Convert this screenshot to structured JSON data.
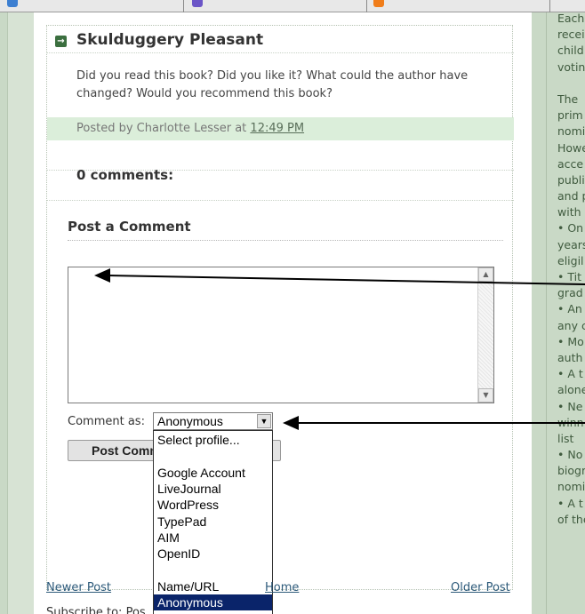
{
  "post": {
    "title": "Skulduggery Pleasant",
    "body": "Did you read this book? Did you like it? What could the author have changed? Would you recommend this book?",
    "footer_prefix": "Posted by Charlotte Lesser at",
    "footer_time": "12:49 PM",
    "comments_count": "0 comments:",
    "post_comment_heading": "Post a Comment"
  },
  "comment_form": {
    "comment_as_label": "Comment as:",
    "selected_profile": "Anonymous",
    "submit_label": "Post Comment",
    "profile_options": [
      "Select profile...",
      "",
      "Google Account",
      "LiveJournal",
      "WordPress",
      "TypePad",
      "AIM",
      "OpenID",
      "",
      "Name/URL",
      "Anonymous"
    ]
  },
  "nav": {
    "newer": "Newer Post",
    "home": "Home",
    "older": "Older Post",
    "subscribe_prefix": "Subscribe to: Pos"
  },
  "sidebar_snippet": [
    "Each",
    "recei",
    "child",
    "votin",
    "",
    "The",
    "prim",
    "nomi",
    "Howe",
    "acce",
    "publi",
    "and p",
    "with",
    "• On",
    "years",
    "eligil",
    "• Tit",
    "grad",
    "• An",
    "any c",
    "• Mo",
    "auth",
    "• A t",
    "alone",
    "• Ne",
    "winn",
    "list",
    "• No",
    "biogr",
    "nomi",
    "• A t",
    "of the"
  ],
  "colors": {
    "accent_green": "#3b6f3f",
    "footer_bg": "#dbeeda",
    "selection": "#0a246a",
    "side_bg": "#c9d9c6"
  }
}
